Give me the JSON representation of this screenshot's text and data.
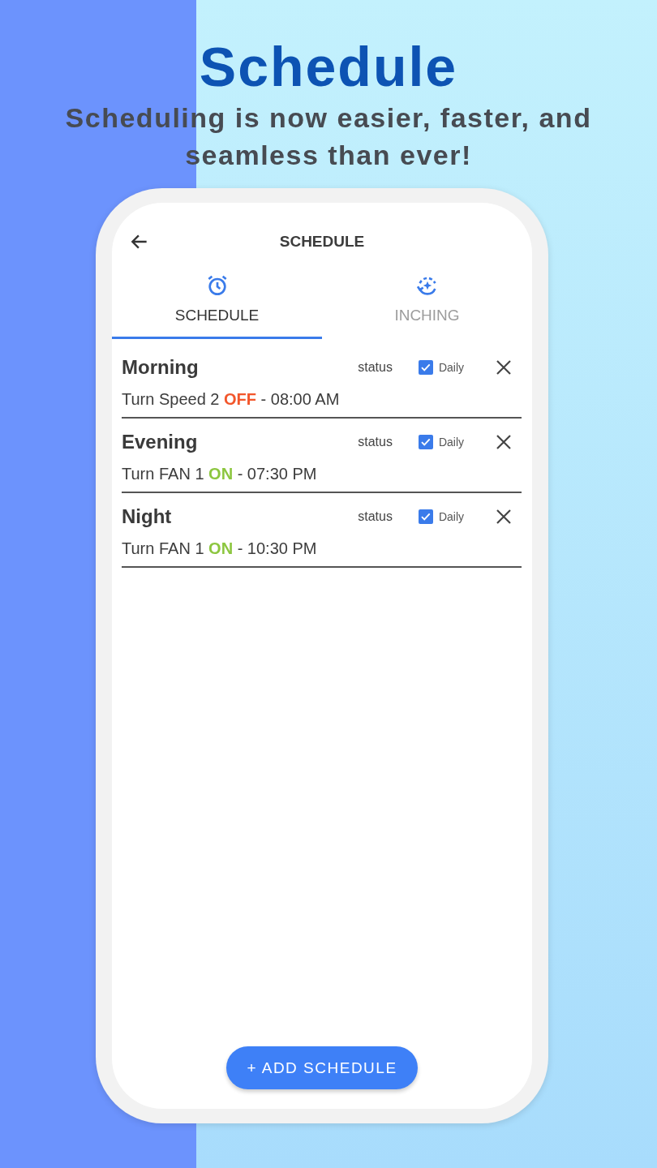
{
  "headline": {
    "title": "Schedule",
    "subtitle": "Scheduling is now easier, faster, and seamless than ever!"
  },
  "app_bar": {
    "title": "SCHEDULE"
  },
  "tabs": [
    {
      "label": "SCHEDULE",
      "kind": "alarm",
      "selected": true
    },
    {
      "label": "INCHING",
      "kind": "cycle",
      "selected": false
    }
  ],
  "schedules": [
    {
      "name": "Morning",
      "status_label": "status",
      "daily_label": "Daily",
      "daily_checked": true,
      "prefix": "Turn Speed 2",
      "action": "OFF",
      "kind": "off",
      "time": "- 08:00 AM"
    },
    {
      "name": "Evening",
      "status_label": "status",
      "daily_label": "Daily",
      "daily_checked": true,
      "prefix": "Turn FAN 1",
      "action": "ON",
      "kind": "on",
      "time": "- 07:30 PM"
    },
    {
      "name": "Night",
      "status_label": "status",
      "daily_label": "Daily",
      "daily_checked": true,
      "prefix": "Turn FAN 1",
      "action": "ON",
      "kind": "on",
      "time": "- 10:30 PM"
    }
  ],
  "add_button": "+ ADD SCHEDULE"
}
